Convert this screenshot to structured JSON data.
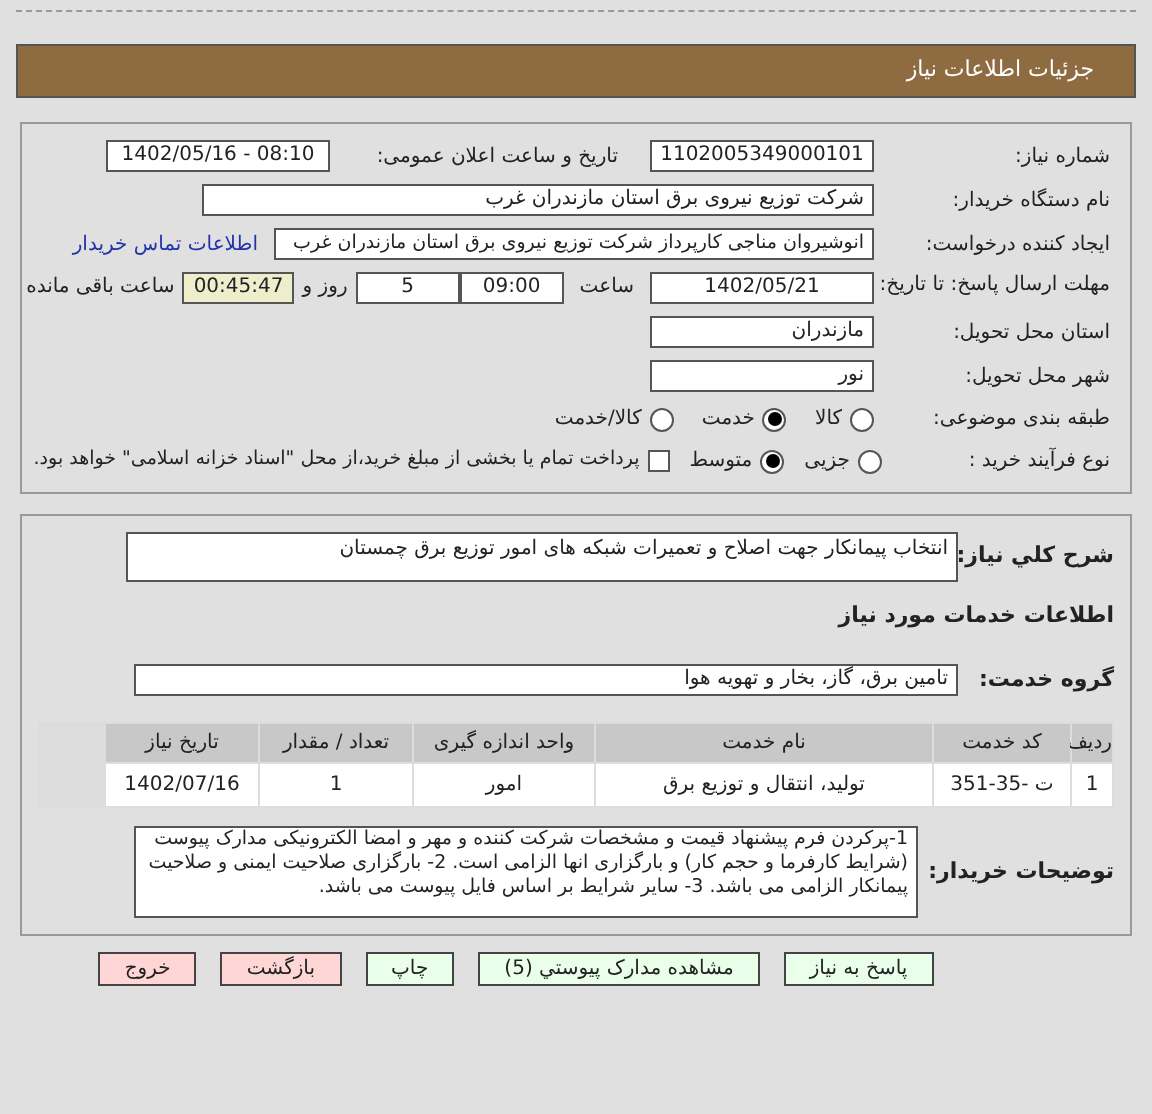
{
  "header": {
    "title": "جزئیات اطلاعات نیاز"
  },
  "need_number": {
    "label": "شماره نیاز:",
    "value": "1102005349000101"
  },
  "announce": {
    "label": "تاریخ و ساعت اعلان عمومی:",
    "value": "1402/05/16 - 08:10"
  },
  "buyer": {
    "label": "نام دستگاه خریدار:",
    "value": "شرکت توزیع نیروی برق استان مازندران غرب"
  },
  "creator": {
    "label": "ایجاد کننده درخواست:",
    "value": "انوشیروان مناجی کارپرداز شرکت توزیع نیروی برق استان مازندران غرب",
    "link": "اطلاعات تماس خریدار"
  },
  "deadline": {
    "label": "مهلت ارسال پاسخ: تا تاریخ:",
    "date": "1402/05/21",
    "time_label": "ساعت",
    "time": "09:00",
    "days": "5",
    "days_label": "روز و",
    "remaining": "00:45:47",
    "remaining_label": "ساعت باقی مانده"
  },
  "province": {
    "label": "استان محل تحویل:",
    "value": "مازندران"
  },
  "city": {
    "label": "شهر محل تحویل:",
    "value": "نور"
  },
  "category": {
    "label": "طبقه بندی موضوعی:",
    "options": [
      {
        "label": "کالا",
        "selected": false
      },
      {
        "label": "خدمت",
        "selected": true
      },
      {
        "label": "کالا/خدمت",
        "selected": false
      }
    ]
  },
  "process": {
    "label": "نوع فرآیند خرید :",
    "options": [
      {
        "label": "جزیی",
        "selected": false
      },
      {
        "label": "متوسط",
        "selected": true
      }
    ],
    "payment": {
      "label": "پرداخت تمام یا بخشی از مبلغ خرید،از محل \"اسناد خزانه اسلامی\" خواهد بود.",
      "checked": false
    }
  },
  "summary": {
    "label": "شرح کلي نیاز:",
    "value": "انتخاب پیمانکار جهت اصلاح و تعمیرات شبکه های امور توزیع برق چمستان"
  },
  "services_heading": "اطلاعات خدمات مورد نیاز",
  "service_group": {
    "label": "گروه خدمت:",
    "value": "تامین برق، گاز، بخار و تهویه هوا"
  },
  "table": {
    "columns": [
      "ردیف",
      "کد خدمت",
      "نام خدمت",
      "واحد اندازه گیری",
      "تعداد / مقدار",
      "تاریخ نیاز"
    ],
    "rows": [
      [
        "1",
        "ت -35-351",
        "تولید، انتقال و توزیع برق",
        "امور",
        "1",
        "1402/07/16"
      ]
    ]
  },
  "notes": {
    "label": "توضیحات خریدار:",
    "value": "1-پرکردن فرم پیشنهاد قیمت و مشخصات شرکت کننده و مهر و امضا الکترونیکی مدارک پیوست (شرایط کارفرما و حجم کار) و بارگزاری انها الزامی است. 2- بارگزاری صلاحیت ایمنی و صلاحیت پیمانکار الزامی می باشد. 3- سایر شرایط بر اساس فایل پیوست می باشد."
  },
  "buttons": [
    {
      "label": "پاسخ به نیاز",
      "kind": "normal"
    },
    {
      "label": "مشاهده مدارک پیوستي (5)",
      "kind": "normal"
    },
    {
      "label": "چاپ",
      "kind": "normal"
    },
    {
      "label": "بازگشت",
      "kind": "exit"
    },
    {
      "label": "خروج",
      "kind": "exit"
    }
  ]
}
